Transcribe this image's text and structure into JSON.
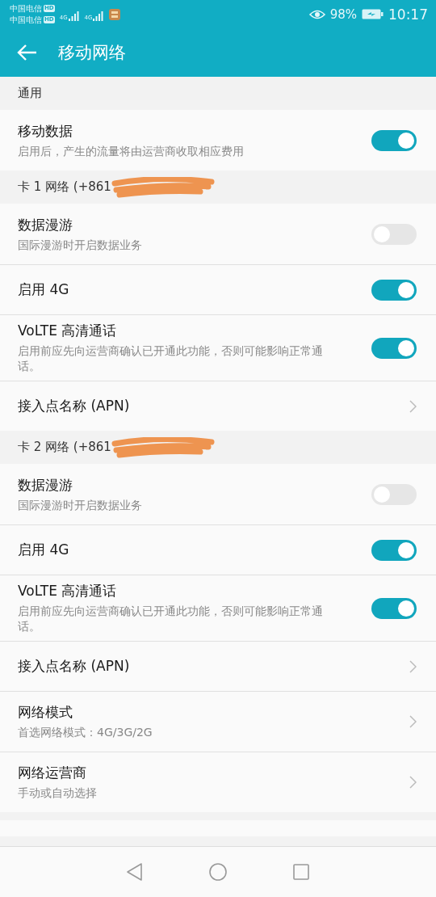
{
  "status_bar": {
    "carriers": [
      {
        "name": "中国电信",
        "badge": "HD"
      },
      {
        "name": "中国电信",
        "badge": "HD"
      }
    ],
    "signals": [
      "4G",
      "4G"
    ],
    "battery": "98%",
    "time": "10:17"
  },
  "toolbar": {
    "title": "移动网络"
  },
  "sections": [
    {
      "header": "通用",
      "items": [
        {
          "kind": "toggle",
          "title": "移动数据",
          "subtitle": "启用后，产生的流量将由运营商收取相应费用",
          "on": true
        }
      ]
    },
    {
      "header": "卡 1 网络 (+861",
      "redacted": true,
      "items": [
        {
          "kind": "toggle",
          "title": "数据漫游",
          "subtitle": "国际漫游时开启数据业务",
          "on": false
        },
        {
          "kind": "toggle",
          "title": "启用 4G",
          "on": true
        },
        {
          "kind": "toggle",
          "title": "VoLTE 高清通话",
          "subtitle": "启用前应先向运营商确认已开通此功能，否则可能影响正常通话。",
          "on": true
        },
        {
          "kind": "link",
          "title": "接入点名称 (APN)"
        }
      ]
    },
    {
      "header": "卡 2 网络 (+861",
      "redacted": true,
      "items": [
        {
          "kind": "toggle",
          "title": "数据漫游",
          "subtitle": "国际漫游时开启数据业务",
          "on": false
        },
        {
          "kind": "toggle",
          "title": "启用 4G",
          "on": true
        },
        {
          "kind": "toggle",
          "title": "VoLTE 高清通话",
          "subtitle": "启用前应先向运营商确认已开通此功能，否则可能影响正常通话。",
          "on": true
        },
        {
          "kind": "link",
          "title": "接入点名称 (APN)"
        },
        {
          "kind": "link",
          "title": "网络模式",
          "subtitle": "首选网络模式：4G/3G/2G"
        },
        {
          "kind": "link",
          "title": "网络运营商",
          "subtitle": "手动或自动选择"
        }
      ]
    }
  ]
}
